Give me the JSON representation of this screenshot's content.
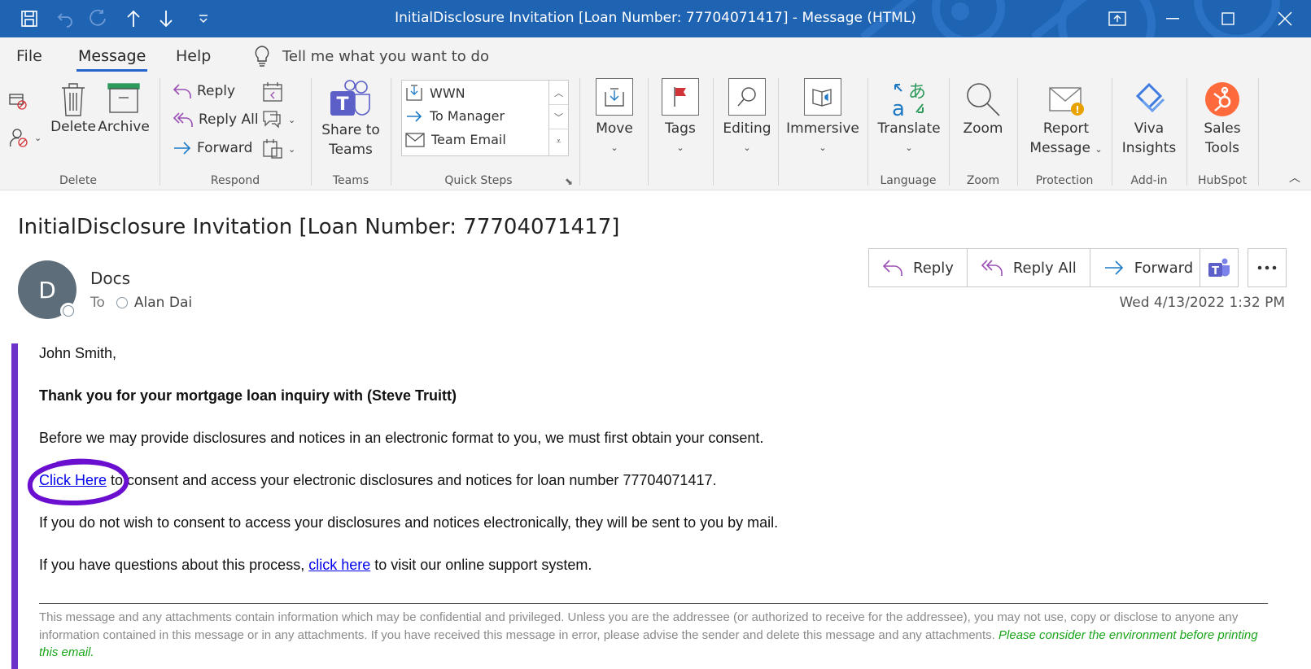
{
  "window": {
    "title": "InitialDisclosure Invitation [Loan Number: 77704071417]  -  Message (HTML)"
  },
  "menu": {
    "tabs": [
      "File",
      "Message",
      "Help"
    ],
    "tell_me": "Tell me what you want to do"
  },
  "ribbon": {
    "delete_group": {
      "delete": "Delete",
      "archive": "Archive",
      "label": "Delete"
    },
    "respond_group": {
      "reply": "Reply",
      "reply_all": "Reply All",
      "forward": "Forward",
      "label": "Respond"
    },
    "teams_group": {
      "share_line1": "Share to",
      "share_line2": "Teams",
      "label": "Teams"
    },
    "quick_steps": {
      "items": [
        "WWN",
        "To Manager",
        "Team Email"
      ],
      "label": "Quick Steps"
    },
    "move": "Move",
    "tags": "Tags",
    "editing": "Editing",
    "immersive": "Immersive",
    "language_group": {
      "translate": "Translate",
      "label": "Language"
    },
    "zoom_group": {
      "zoom": "Zoom",
      "label": "Zoom"
    },
    "protection_group": {
      "report_line1": "Report",
      "report_line2": "Message",
      "label": "Protection"
    },
    "addin_group": {
      "viva_line1": "Viva",
      "viva_line2": "Insights",
      "label": "Add-in"
    },
    "hubspot_group": {
      "sales_line1": "Sales",
      "sales_line2": "Tools",
      "label": "HubSpot"
    }
  },
  "message": {
    "subject": "InitialDisclosure Invitation [Loan Number: 77704071417]",
    "avatar_initial": "D",
    "sender": "Docs",
    "to_label": "To",
    "recipient": "Alan Dai",
    "actions": {
      "reply": "Reply",
      "reply_all": "Reply All",
      "forward": "Forward"
    },
    "datetime": "Wed 4/13/2022 1:32 PM"
  },
  "body": {
    "greeting": "John Smith,",
    "thanks": "Thank you for your mortgage loan inquiry with (Steve Truitt)",
    "consent_intro": "Before we may provide disclosures and notices in an electronic format to you, we must first obtain your consent.",
    "click_here_link": "Click Here",
    "consent_rest": " to consent and access your electronic disclosures and notices for loan number 77704071417.",
    "mail_notice": "If you do not wish to consent to access your disclosures and notices electronically, they will be sent to you by mail.",
    "questions_prefix": "If you have questions about this process, ",
    "support_link": "click here",
    "questions_suffix": " to visit our online support system.",
    "disclaimer": "This message and any attachments contain information which may be confidential and privileged. Unless you are the addressee (or authorized to receive for the addressee), you may not use, copy or disclose to anyone any information contained in this message or in any attachments. If you have received this message in error, please advise the sender and delete this message and any attachments. ",
    "environment": "Please consider the environment before printing this email."
  },
  "colors": {
    "titlebar": "#1f63b3",
    "accent_tab": "#2564cf",
    "body_bar": "#6b32c9",
    "annotation_circle": "#6a0fd0",
    "link": "#0000ee"
  }
}
